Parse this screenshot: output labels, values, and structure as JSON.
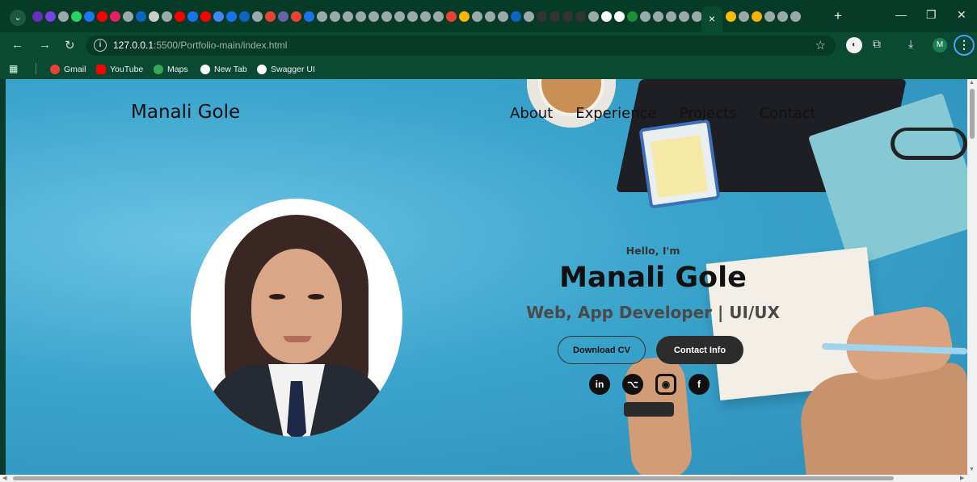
{
  "browser": {
    "url_host": "127.0.0.1",
    "url_path": ":5500/Portfolio-main/index.html",
    "active_tab_close": "×",
    "new_tab": "+",
    "bookmarks": [
      {
        "label": "Gmail",
        "color": "#ea4335"
      },
      {
        "label": "YouTube",
        "color": "#ff0000"
      },
      {
        "label": "Maps",
        "color": "#34a853"
      },
      {
        "label": "New Tab",
        "color": "#ffffff"
      },
      {
        "label": "Swagger UI",
        "color": "#ffffff"
      }
    ],
    "profile_initial": "M",
    "tab_favicon_colors": [
      "#6b2dbd",
      "#7b3fe4",
      "#9aa",
      "#25d366",
      "#1877f2",
      "#ff0000",
      "#e91e63",
      "#9aa",
      "#0a66c2",
      "#ccc",
      "#9aa",
      "#ff0000",
      "#1a73e8",
      "#ff0000",
      "#4285f4",
      "#1a73e8",
      "#0a66c2",
      "#9aa",
      "#ea4335",
      "#6264a7",
      "#ea4335",
      "#1a73e8",
      "#9aa",
      "#9aa",
      "#9aa",
      "#9aa",
      "#9aa",
      "#9aa",
      "#9aa",
      "#9aa",
      "#9aa",
      "#9aa",
      "#ea4335",
      "#f4b400",
      "#9aa",
      "#9aa",
      "#9aa",
      "#0a66c2",
      "#9aa",
      "#333",
      "#333",
      "#333",
      "#333",
      "#9aa",
      "#ffffff",
      "#ffffff",
      "#1e8e3e",
      "#9aa",
      "#9aa",
      "#9aa",
      "#9aa",
      "#9aa",
      "#fbbc04"
    ],
    "tab_favicon_colors_right": [
      "#fbbc04",
      "#9aa",
      "#f4b400",
      "#9aa",
      "#9aa",
      "#9aa"
    ]
  },
  "site": {
    "brand": "Manali Gole",
    "nav": [
      "About",
      "Experience",
      "Projects",
      "Contact"
    ],
    "hero": {
      "greeting": "Hello, I'm",
      "name": "Manali Gole",
      "role": "Web, App Developer | UI/UX",
      "download_cv": "Download CV",
      "contact_info": "Contact Info"
    },
    "socials": [
      {
        "name": "linkedin",
        "glyph": "in"
      },
      {
        "name": "github",
        "glyph": "⌥"
      },
      {
        "name": "instagram",
        "glyph": "◉"
      },
      {
        "name": "facebook",
        "glyph": "f"
      }
    ]
  }
}
